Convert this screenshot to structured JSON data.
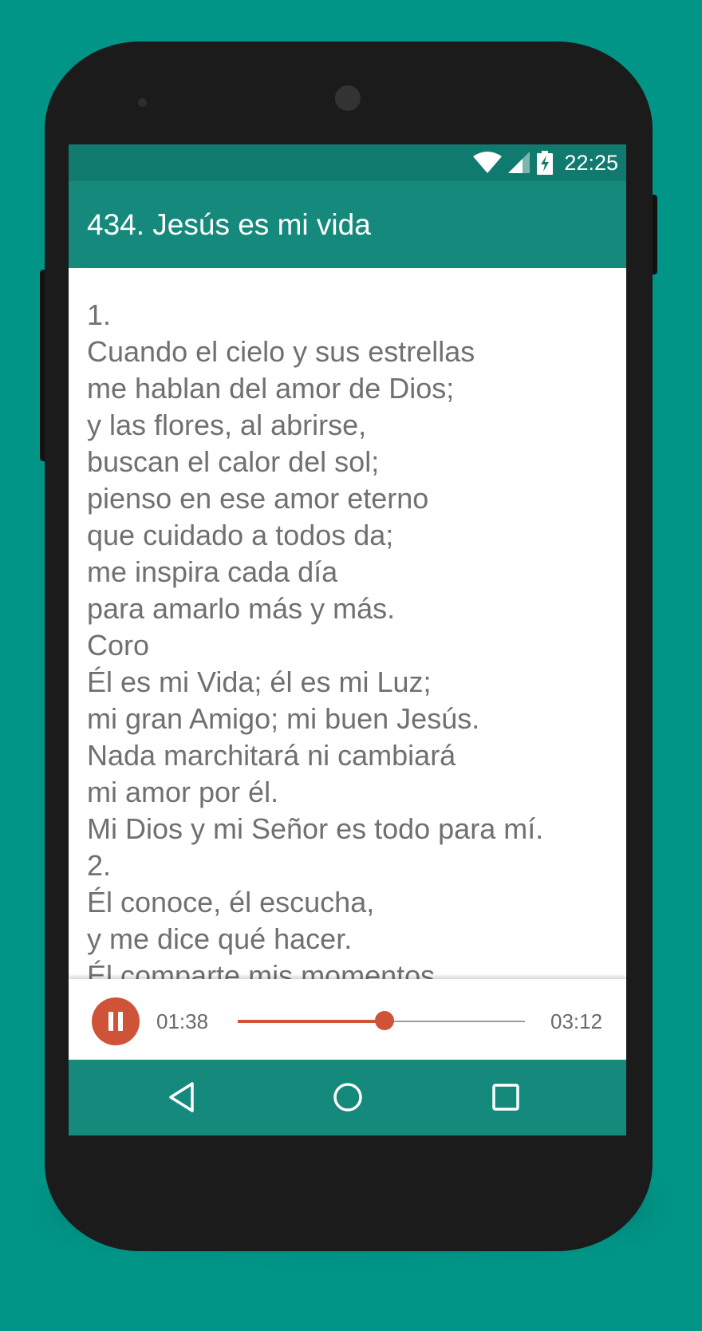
{
  "status_bar": {
    "time": "22:25",
    "icons": [
      "wifi-icon",
      "cell-signal-icon",
      "battery-charging-icon"
    ]
  },
  "app_bar": {
    "title": "434. Jesús es mi vida"
  },
  "lyrics": {
    "lines": [
      "1.",
      "Cuando el cielo y sus estrellas",
      "me hablan del amor de Dios;",
      "y las flores, al abrirse,",
      "buscan el calor del sol;",
      "pienso en ese amor eterno",
      "que cuidado a todos da;",
      "me inspira cada día",
      "para amarlo más y más.",
      "Coro",
      "Él es mi Vida; él es mi Luz;",
      "mi gran Amigo; mi buen Jesús.",
      "Nada marchitará ni cambiará",
      "mi amor por él.",
      "Mi Dios y mi Señor es todo para mí.",
      "2.",
      "Él conoce, él escucha,",
      "y me dice qué hacer.",
      "Él comparte mis momentos"
    ]
  },
  "player": {
    "state_icon": "pause-icon",
    "current_time": "01:38",
    "total_time": "03:12",
    "progress_fraction": 0.51
  },
  "nav_bar": {
    "icons": [
      "back-icon",
      "home-icon",
      "recents-icon"
    ]
  },
  "colors": {
    "background": "#009587",
    "status_bar": "#117a6e",
    "app_bar": "#15897c",
    "accent": "#cf5437",
    "lyric_text": "#707070"
  }
}
